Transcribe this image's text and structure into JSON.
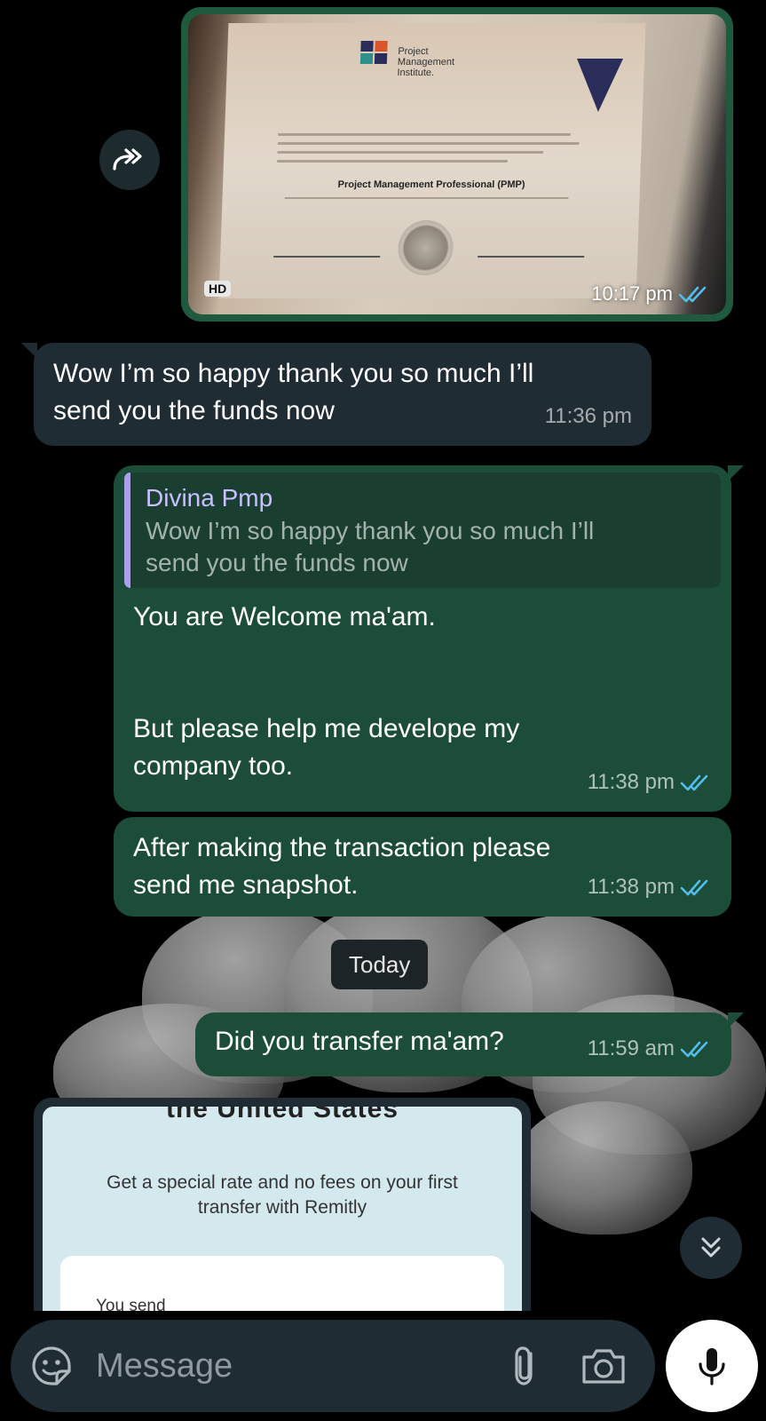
{
  "image_message": {
    "hd_badge": "HD",
    "time": "10:17 pm",
    "certificate": {
      "org_line1": "Project",
      "org_line2": "Management",
      "org_line3": "Institute.",
      "title": "Project Management Professional (PMP)"
    }
  },
  "messages": [
    {
      "direction": "incoming",
      "text_line1": "Wow I’m so happy thank you so much I’ll",
      "text_line2": "send you the funds now",
      "time": "11:36 pm"
    },
    {
      "direction": "outgoing",
      "reply_to_name": "Divina Pmp",
      "reply_to_line1": "Wow I’m so happy thank you so much I’ll",
      "reply_to_line2": "send you the funds now",
      "text_line1": "You are Welcome ma'am.",
      "text_line2": "But please help me develope my",
      "text_line3": "company too.",
      "time": "11:38 pm"
    },
    {
      "direction": "outgoing",
      "text_line1": "After making the transaction please",
      "text_line2": "send me snapshot.",
      "time": "11:38 pm"
    },
    {
      "direction": "outgoing",
      "text": "Did you transfer ma'am?",
      "time": "11:59 am"
    }
  ],
  "date_separator": "Today",
  "screenshot_message": {
    "cut_heading": "the United States",
    "line1": "Get a special rate and no fees on your first",
    "line2": "transfer with Remitly",
    "field_label": "You send"
  },
  "composer": {
    "placeholder": "Message"
  },
  "colors": {
    "incoming_bubble": "#202c33",
    "outgoing_bubble": "#1b4d38",
    "read_ticks": "#53bdeb",
    "quote_accent": "#a9a0e8"
  },
  "icons": {
    "forward": "forward-icon",
    "ticks": "double-check-icon",
    "scroll": "double-chevron-down-icon",
    "emoji": "sticker-icon",
    "attach": "paperclip-icon",
    "camera": "camera-icon",
    "mic": "microphone-icon"
  }
}
